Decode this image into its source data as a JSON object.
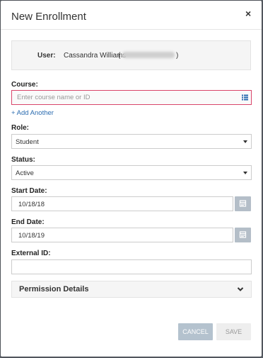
{
  "dialog": {
    "title": "New Enrollment",
    "close_label": "×"
  },
  "user": {
    "label": "User:",
    "name": "Cassandra Williams",
    "id_open": "(",
    "id_close": ")"
  },
  "course": {
    "label": "Course:",
    "placeholder": "Enter course name or ID",
    "value": "",
    "add_another": "+ Add Another"
  },
  "role": {
    "label": "Role:",
    "selected": "Student"
  },
  "status": {
    "label": "Status:",
    "selected": "Active"
  },
  "start_date": {
    "label": "Start Date:",
    "value": "10/18/18"
  },
  "end_date": {
    "label": "End Date:",
    "value": "10/18/19"
  },
  "external_id": {
    "label": "External ID:",
    "value": ""
  },
  "permission_details": {
    "label": "Permission Details",
    "icon": "chevron-down-icon"
  },
  "actions": {
    "cancel": "CANCEL",
    "save": "SAVE"
  },
  "colors": {
    "invalid_border": "#d9456a",
    "link": "#2b6cb0",
    "calendar_button": "#b4bec8",
    "cancel_button": "#b4c2ce",
    "save_button": "#eeeeee"
  }
}
